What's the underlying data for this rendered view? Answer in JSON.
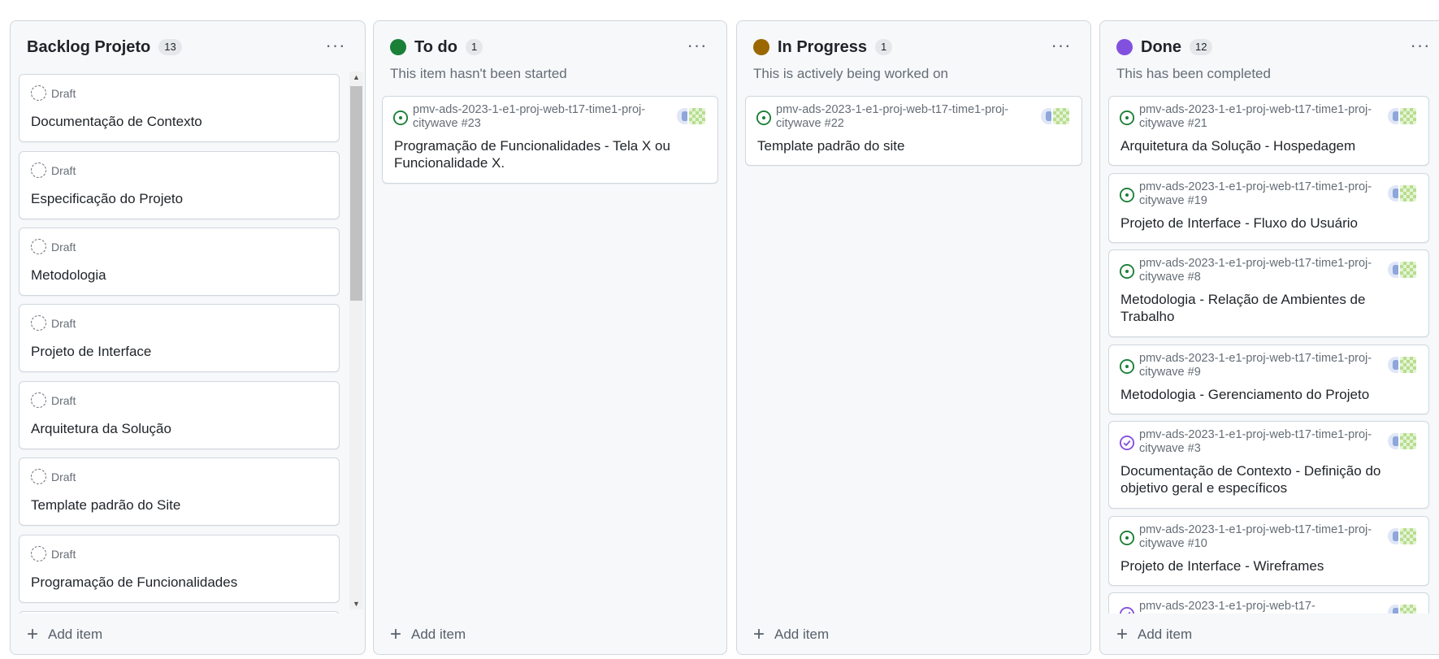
{
  "columns": [
    {
      "title": "Backlog Projeto",
      "count": "13",
      "menu": "···",
      "cards": [
        {
          "badge": "Draft",
          "title": "Documentação de Contexto"
        },
        {
          "badge": "Draft",
          "title": "Especificação do Projeto"
        },
        {
          "badge": "Draft",
          "title": "Metodologia"
        },
        {
          "badge": "Draft",
          "title": "Projeto de Interface"
        },
        {
          "badge": "Draft",
          "title": "Arquitetura da Solução"
        },
        {
          "badge": "Draft",
          "title": "Template padrão do Site"
        },
        {
          "badge": "Draft",
          "title": "Programação de Funcionalidades"
        }
      ],
      "add_label": "Add item"
    },
    {
      "title": "To do",
      "count": "1",
      "menu": "···",
      "dot_color": "#1a7f37",
      "description": "This item hasn't been started",
      "cards": [
        {
          "repo": "pmv-ads-2023-1-e1-proj-web-t17-time1-proj-citywave #23",
          "title": "Programação de Funcionalidades - Tela X ou Funcionalidade X.",
          "status": "open"
        }
      ],
      "add_label": "Add item"
    },
    {
      "title": "In Progress",
      "count": "1",
      "menu": "···",
      "dot_color": "#9a6700",
      "description": "This is actively being worked on",
      "cards": [
        {
          "repo": "pmv-ads-2023-1-e1-proj-web-t17-time1-proj-citywave #22",
          "title": "Template padrão do site",
          "status": "open"
        }
      ],
      "add_label": "Add item"
    },
    {
      "title": "Done",
      "count": "12",
      "menu": "···",
      "dot_color": "#8250df",
      "description": "This has been completed",
      "cards": [
        {
          "repo": "pmv-ads-2023-1-e1-proj-web-t17-time1-proj-citywave #21",
          "title": "Arquitetura da Solução - Hospedagem",
          "status": "open"
        },
        {
          "repo": "pmv-ads-2023-1-e1-proj-web-t17-time1-proj-citywave #19",
          "title": "Projeto de Interface - Fluxo do Usuário",
          "status": "open"
        },
        {
          "repo": "pmv-ads-2023-1-e1-proj-web-t17-time1-proj-citywave #8",
          "title": "Metodologia - Relação de Ambientes de Trabalho",
          "status": "open"
        },
        {
          "repo": "pmv-ads-2023-1-e1-proj-web-t17-time1-proj-citywave #9",
          "title": "Metodologia - Gerenciamento do Projeto",
          "status": "open"
        },
        {
          "repo": "pmv-ads-2023-1-e1-proj-web-t17-time1-proj-citywave #3",
          "title": "Documentação de Contexto - Definição do objetivo geral e específicos",
          "status": "closed"
        },
        {
          "repo": "pmv-ads-2023-1-e1-proj-web-t17-time1-proj-citywave #10",
          "title": "Projeto de Interface - Wireframes",
          "status": "open"
        },
        {
          "repo": "pmv-ads-2023-1-e1-proj-web-t17-",
          "title": "",
          "status": "closed"
        }
      ],
      "add_label": "Add item"
    }
  ],
  "colors": {
    "open_issue": "#1a7f37",
    "closed_issue": "#8250df",
    "draft": "#656d76"
  },
  "icons": {
    "draft": "draft-issue-icon",
    "open": "issue-opened-icon",
    "closed": "issue-closed-icon",
    "add": "plus-icon",
    "menu": "kebab-horizontal-icon"
  }
}
